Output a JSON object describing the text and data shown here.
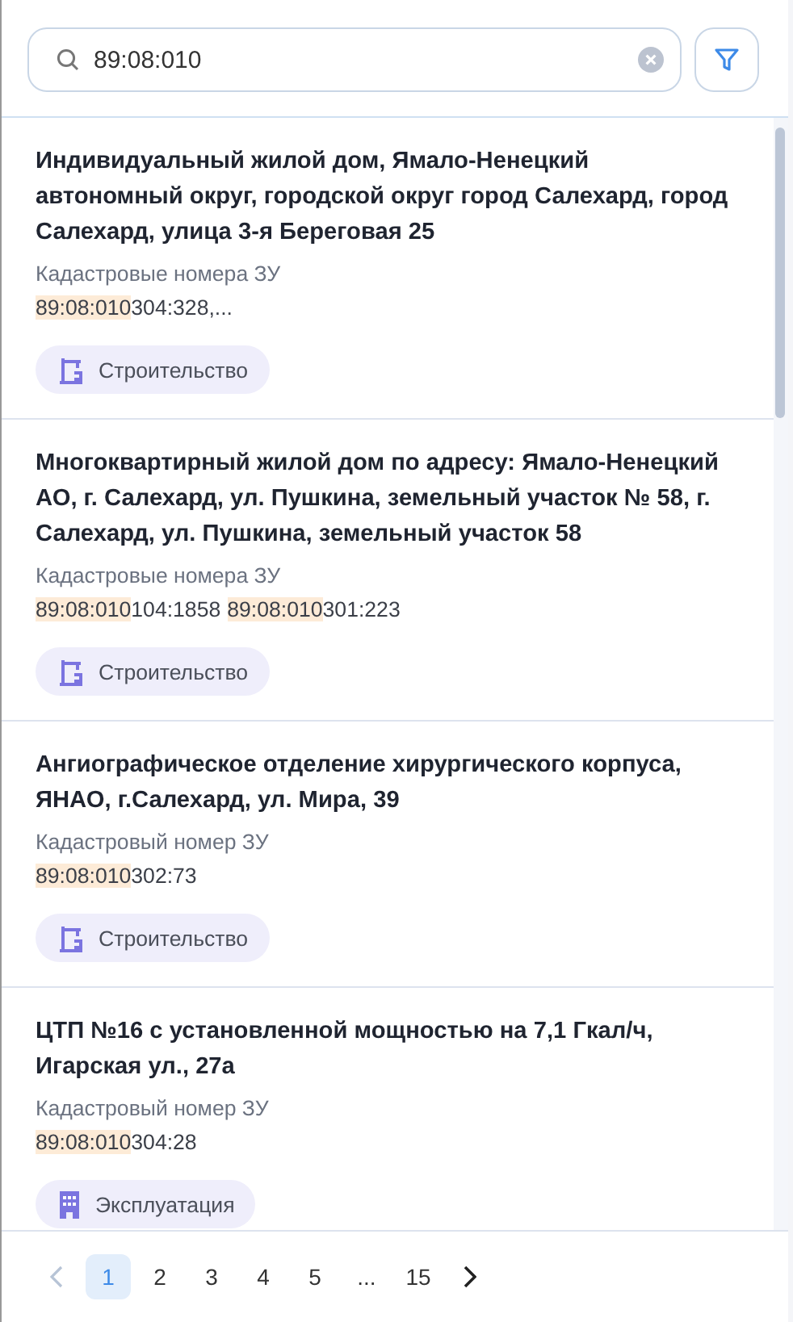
{
  "search": {
    "value": "89:08:010"
  },
  "results": [
    {
      "title": "Индивидуальный жилой дом, Ямало-Ненецкий автономный округ, городской округ город Салехард, город Салехард, улица 3-я Береговая 25",
      "label": "Кадастровые номера ЗУ",
      "numbers": [
        {
          "match": "89:08:010",
          "rest": "304:328,..."
        }
      ],
      "tag": {
        "kind": "construction",
        "label": "Строительство"
      }
    },
    {
      "title": "Многоквартирный жилой дом по адресу: Ямало-Ненецкий АО, г. Салехард, ул. Пушкина, земельный участок № 58, г. Салехард, ул. Пушкина, земельный участок 58",
      "label": "Кадастровые номера ЗУ",
      "numbers": [
        {
          "match": "89:08:010",
          "rest": "104:1858"
        },
        {
          "match": "89:08:010",
          "rest": "301:223"
        }
      ],
      "tag": {
        "kind": "construction",
        "label": "Строительство"
      }
    },
    {
      "title": "Ангиографическое отделение хирургического корпуса, ЯНАО, г.Салехард, ул. Мира, 39",
      "label": "Кадастровый номер ЗУ",
      "numbers": [
        {
          "match": "89:08:010",
          "rest": "302:73"
        }
      ],
      "tag": {
        "kind": "construction",
        "label": "Строительство"
      }
    },
    {
      "title": "ЦТП №16 с установленной мощностью на 7,1 Гкал/ч, Игарская ул., 27а",
      "label": "Кадастровый номер ЗУ",
      "numbers": [
        {
          "match": "89:08:010",
          "rest": "304:28"
        }
      ],
      "tag": {
        "kind": "operation",
        "label": "Эксплуатация"
      }
    }
  ],
  "pagination": {
    "prev_disabled": true,
    "pages": [
      {
        "label": "1",
        "selected": true
      },
      {
        "label": "2",
        "selected": false
      },
      {
        "label": "3",
        "selected": false
      },
      {
        "label": "4",
        "selected": false
      },
      {
        "label": "5",
        "selected": false
      },
      {
        "label": "...",
        "selected": false
      },
      {
        "label": "15",
        "selected": false
      }
    ]
  }
}
